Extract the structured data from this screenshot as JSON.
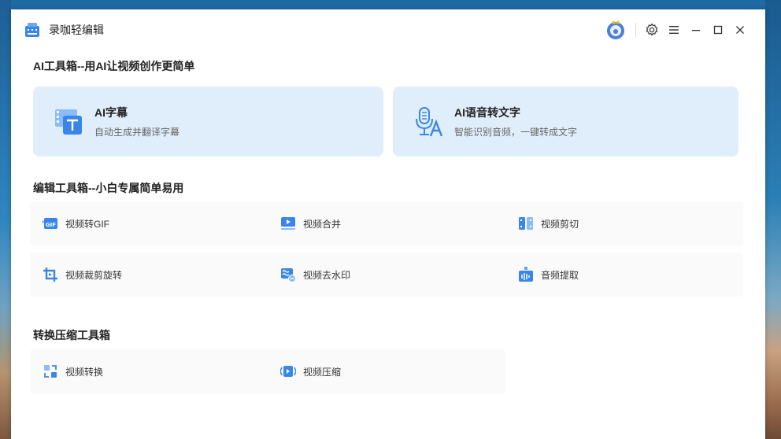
{
  "app": {
    "title": "录咖轻编辑"
  },
  "colors": {
    "accent": "#3a86e8",
    "card_bg": "#e0eefc"
  },
  "sections": {
    "ai": {
      "title": "AI工具箱--用AI让视频创作更简单"
    },
    "edit": {
      "title": "编辑工具箱--小白专属简单易用"
    },
    "convert": {
      "title": "转换压缩工具箱"
    }
  },
  "ai_tools": [
    {
      "name": "AI字幕",
      "desc": "自动生成并翻译字幕",
      "icon": "subtitle-icon"
    },
    {
      "name": "AI语音转文字",
      "desc": "智能识别音频，一键转成文字",
      "icon": "mic-text-icon"
    }
  ],
  "edit_tools": [
    {
      "label": "视频转GIF",
      "icon": "gif-icon"
    },
    {
      "label": "视频合并",
      "icon": "merge-icon"
    },
    {
      "label": "视频剪切",
      "icon": "cut-icon"
    },
    {
      "label": "视频裁剪旋转",
      "icon": "crop-icon"
    },
    {
      "label": "视频去水印",
      "icon": "watermark-icon"
    },
    {
      "label": "音频提取",
      "icon": "audio-extract-icon"
    }
  ],
  "convert_tools": [
    {
      "label": "视频转换",
      "icon": "convert-icon"
    },
    {
      "label": "视频压缩",
      "icon": "compress-icon"
    }
  ]
}
